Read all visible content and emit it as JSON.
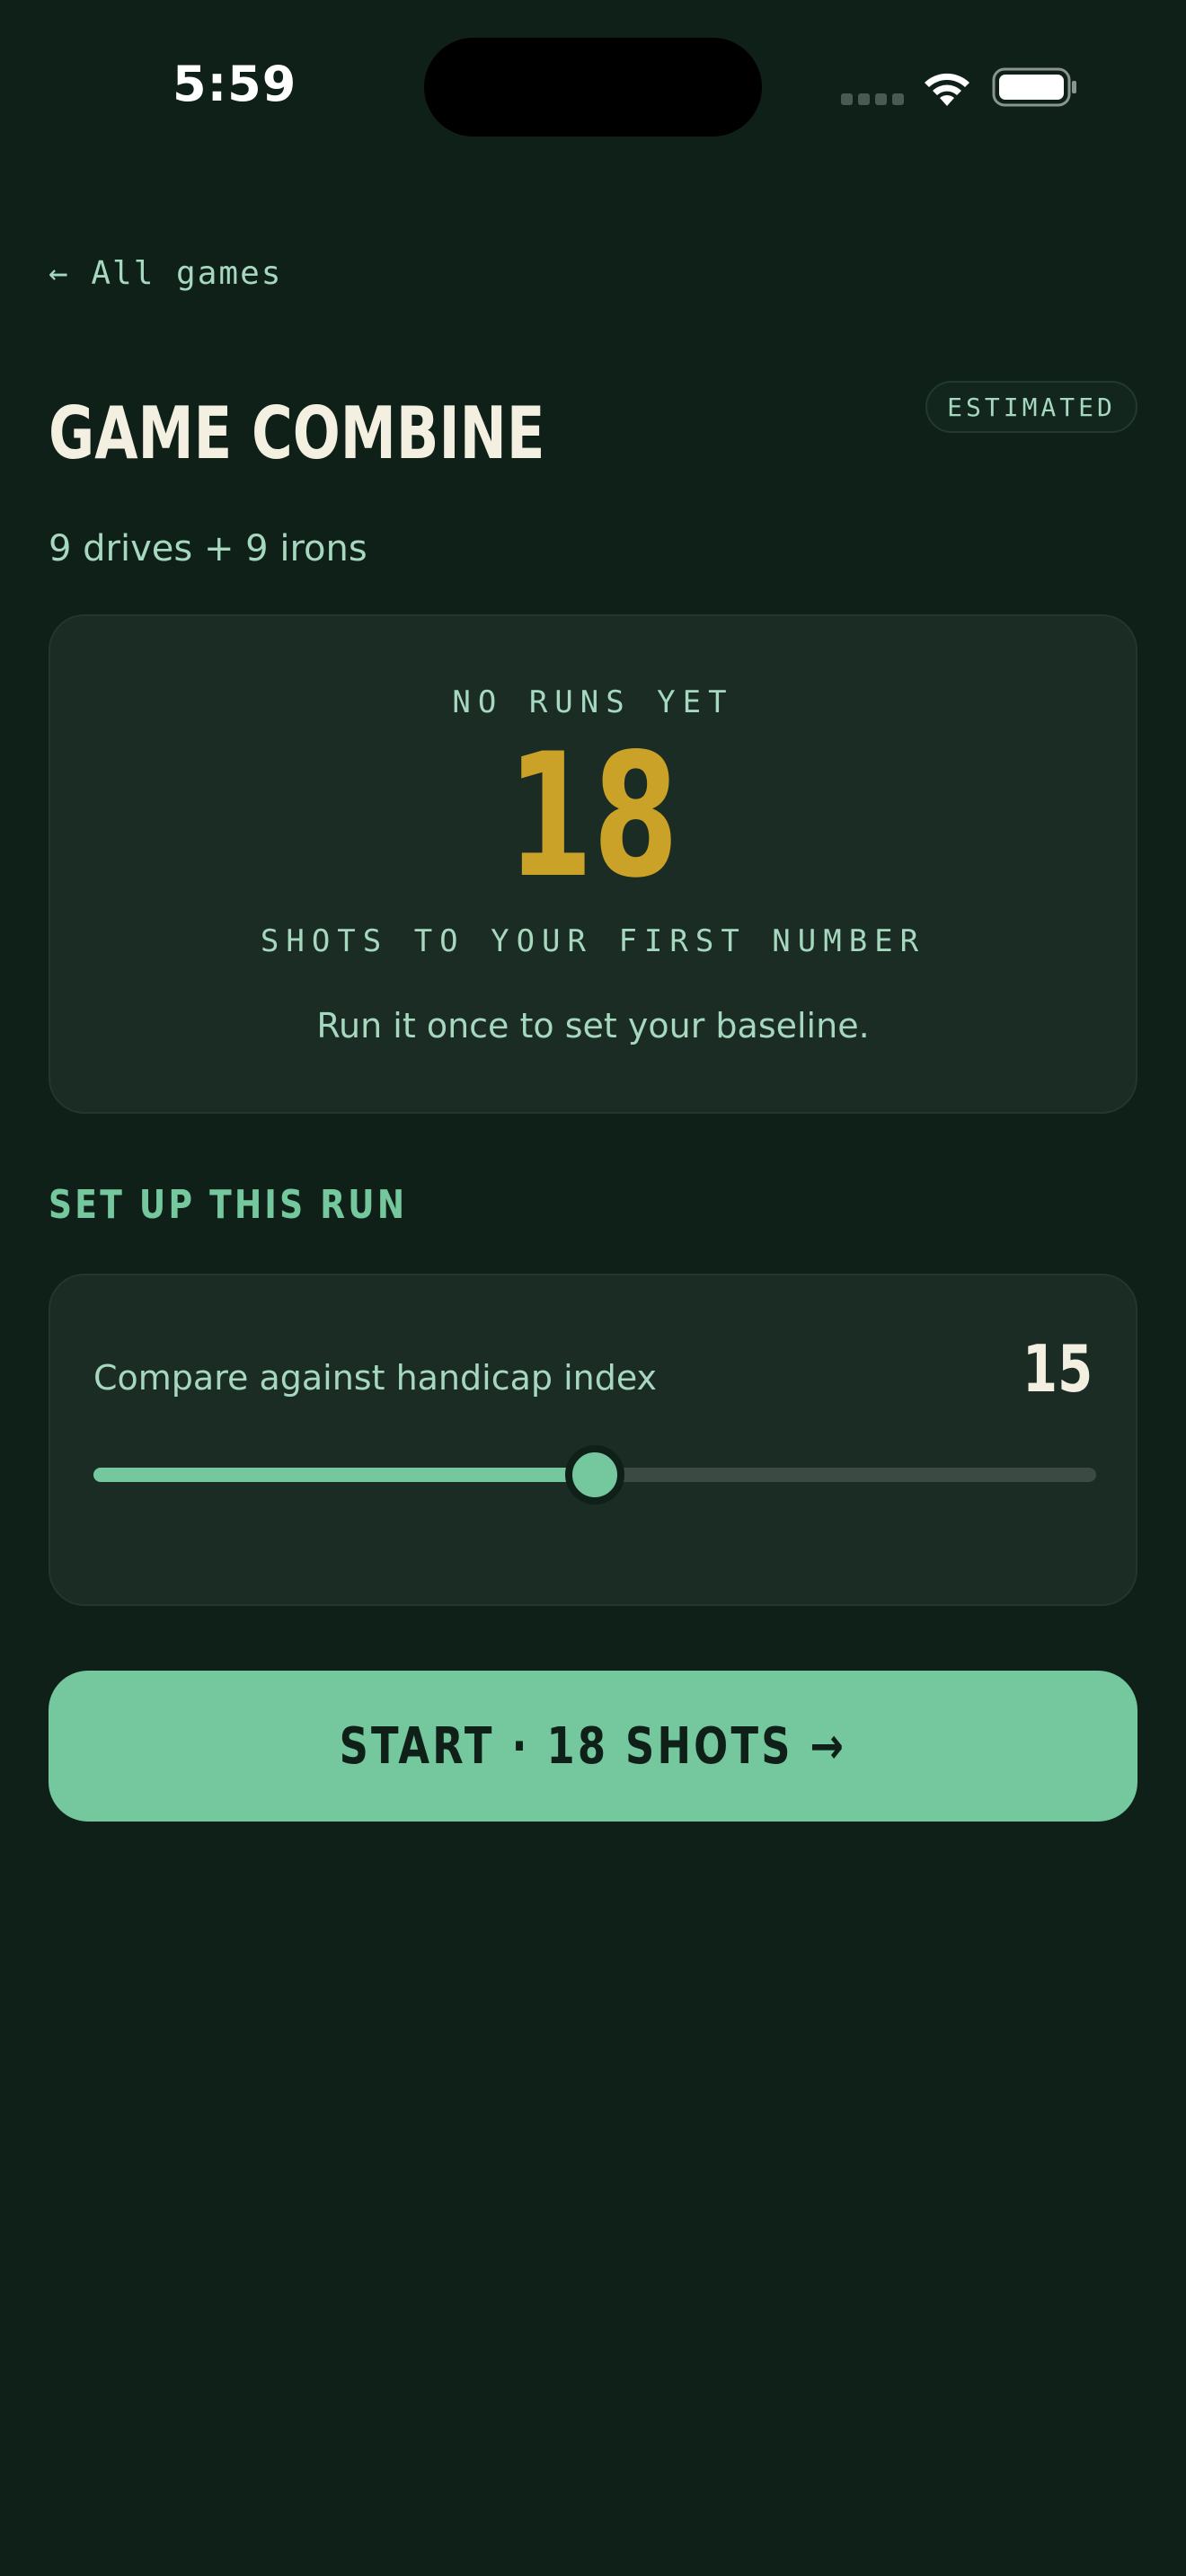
{
  "status_bar": {
    "time": "5:59"
  },
  "nav": {
    "back_label": "← All games"
  },
  "header": {
    "title": "GAME COMBINE",
    "badge": "ESTIMATED",
    "subtitle": "9 drives + 9 irons"
  },
  "runs_card": {
    "kicker": "NO RUNS YET",
    "shots": "18",
    "caption": "SHOTS TO YOUR FIRST NUMBER",
    "note": "Run it once to set your baseline."
  },
  "setup": {
    "heading": "SET UP THIS RUN",
    "handicap_label": "Compare against handicap index",
    "handicap_value": "15",
    "slider_fraction": 0.5
  },
  "start_button": {
    "label": "START · 18 SHOTS →"
  },
  "colors": {
    "background": "#0f2019",
    "accent_green": "#75c79d",
    "accent_gold": "#c9a227",
    "text_light": "#f3f0e2",
    "text_muted": "#a6d7bf"
  }
}
